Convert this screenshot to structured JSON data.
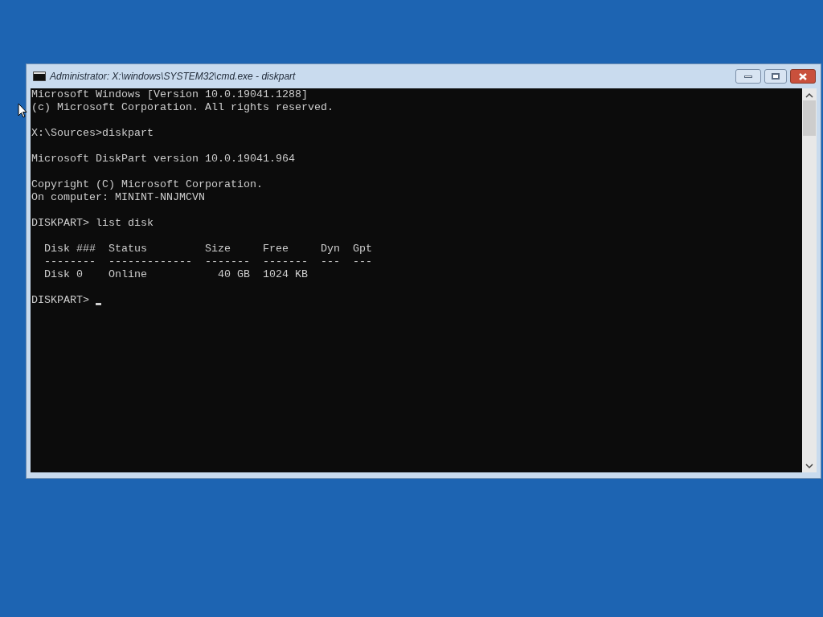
{
  "window": {
    "title": "Administrator: X:\\windows\\SYSTEM32\\cmd.exe - diskpart"
  },
  "console": {
    "blocks": [
      {
        "kind": "text",
        "lines": [
          "Microsoft Windows [Version 10.0.19041.1288]",
          "(c) Microsoft Corporation. All rights reserved."
        ]
      },
      {
        "kind": "text",
        "lines": [
          "X:\\Sources>diskpart"
        ]
      },
      {
        "kind": "text",
        "lines": [
          "Microsoft DiskPart version 10.0.19041.964"
        ]
      },
      {
        "kind": "text",
        "lines": [
          "Copyright (C) Microsoft Corporation.",
          "On computer: MININT-NNJMCVN"
        ]
      },
      {
        "kind": "text",
        "lines": [
          "DISKPART> list disk"
        ]
      },
      {
        "kind": "table",
        "lines": [
          "Disk ###  Status         Size     Free     Dyn  Gpt",
          "--------  -------------  -------  -------  ---  ---",
          "Disk 0    Online           40 GB  1024 KB"
        ]
      },
      {
        "kind": "prompt",
        "lines": [
          "DISKPART>"
        ],
        "cursor": true
      }
    ]
  }
}
